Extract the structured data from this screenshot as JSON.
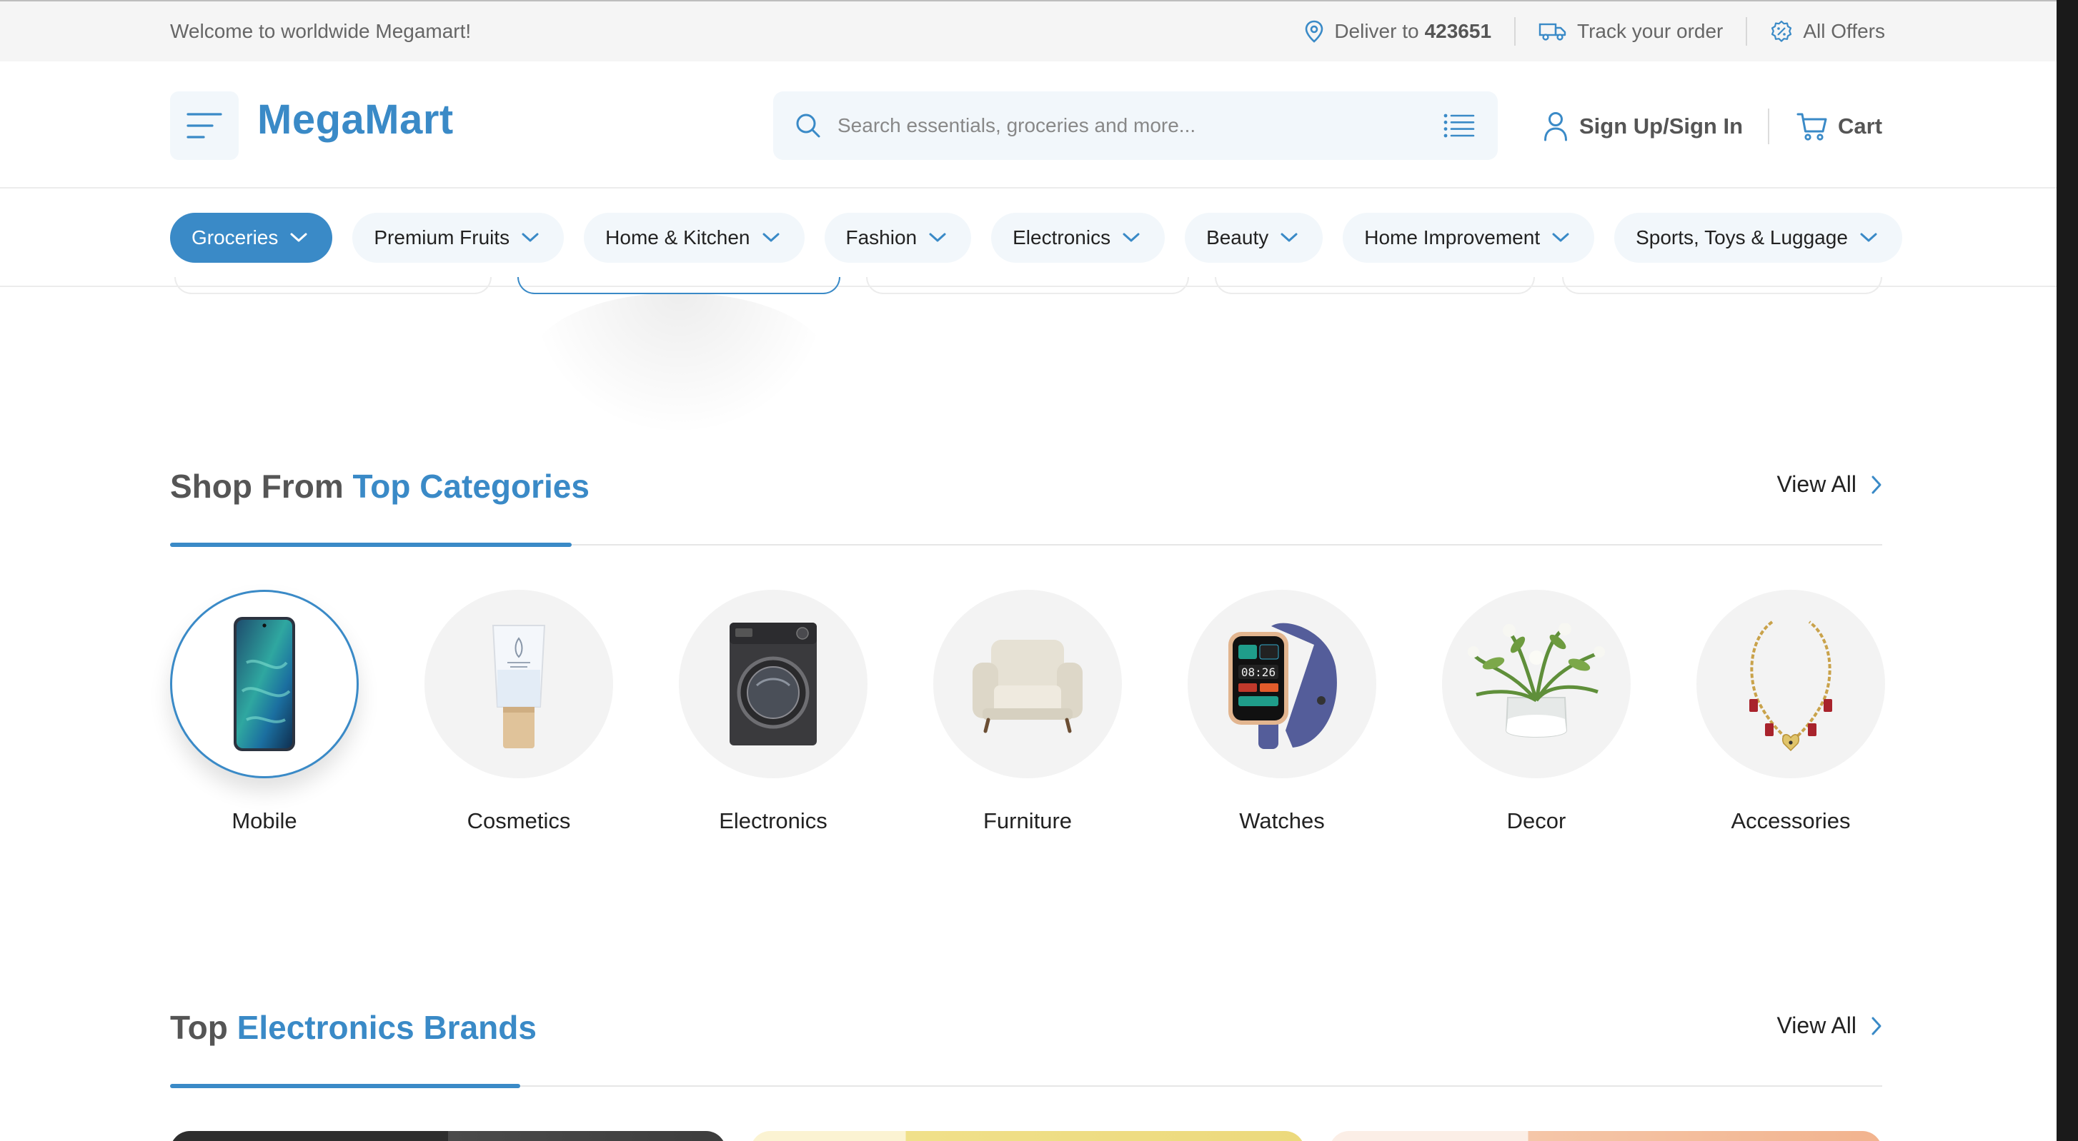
{
  "topbar": {
    "welcome": "Welcome to worldwide Megamart!",
    "deliver_label": "Deliver to",
    "deliver_pincode": "423651",
    "track_label": "Track your order",
    "offers_label": "All Offers"
  },
  "header": {
    "logo": "MegaMart",
    "search_placeholder": "Search essentials, groceries and more...",
    "account_label": "Sign Up/Sign In",
    "cart_label": "Cart"
  },
  "nav": {
    "pills": [
      {
        "label": "Groceries",
        "active": true
      },
      {
        "label": "Premium Fruits"
      },
      {
        "label": "Home & Kitchen"
      },
      {
        "label": "Fashion"
      },
      {
        "label": "Electronics"
      },
      {
        "label": "Beauty"
      },
      {
        "label": "Home Improvement"
      },
      {
        "label": "Sports, Toys & Luggage"
      }
    ]
  },
  "categories_section": {
    "title_lead": "Shop From",
    "title_accent": "Top Categories",
    "view_all": "View All",
    "items": [
      {
        "label": "Mobile",
        "icon": "mobile-phone-icon",
        "selected": true
      },
      {
        "label": "Cosmetics",
        "icon": "cosmetic-tube-icon"
      },
      {
        "label": "Electronics",
        "icon": "washing-machine-icon"
      },
      {
        "label": "Furniture",
        "icon": "armchair-icon"
      },
      {
        "label": "Watches",
        "icon": "smartwatch-icon"
      },
      {
        "label": "Decor",
        "icon": "flower-vase-icon"
      },
      {
        "label": "Accessories",
        "icon": "necklace-icon"
      }
    ]
  },
  "brands_section": {
    "title_lead": "Top",
    "title_accent": "Electronics Brands",
    "view_all": "View All"
  },
  "colors": {
    "accent": "#3a8ac7",
    "pill_bg": "#f2f7fb",
    "circle_bg": "#f3f3f3"
  }
}
